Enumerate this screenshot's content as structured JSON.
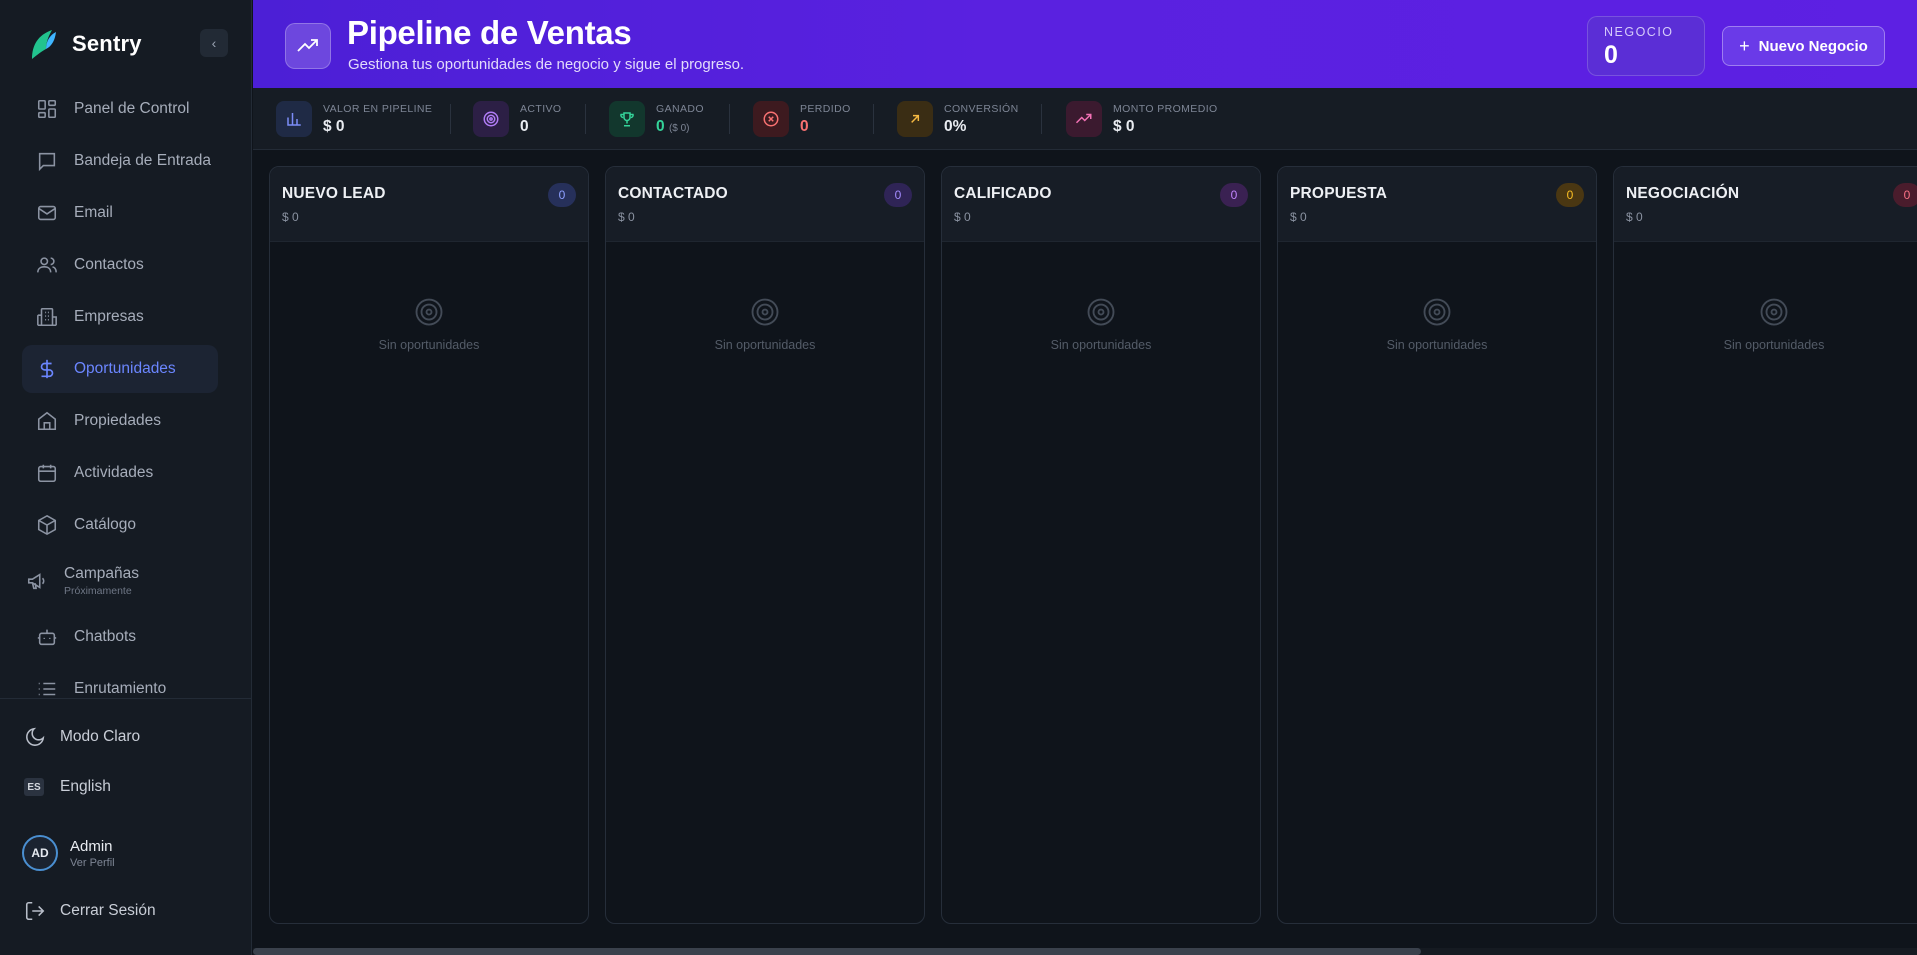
{
  "brand": {
    "name": "Sentry"
  },
  "sidebar": {
    "items": [
      {
        "label": "Panel de Control",
        "icon": "dashboard-icon"
      },
      {
        "label": "Bandeja de Entrada",
        "icon": "inbox-icon"
      },
      {
        "label": "Email",
        "icon": "mail-icon"
      },
      {
        "label": "Contactos",
        "icon": "users-icon"
      },
      {
        "label": "Empresas",
        "icon": "building-icon"
      },
      {
        "label": "Oportunidades",
        "icon": "dollar-icon",
        "active": true
      },
      {
        "label": "Propiedades",
        "icon": "home-icon"
      },
      {
        "label": "Actividades",
        "icon": "calendar-icon"
      },
      {
        "label": "Catálogo",
        "icon": "package-icon"
      },
      {
        "label": "Campañas",
        "sub": "Próximamente",
        "icon": "megaphone-icon"
      },
      {
        "label": "Chatbots",
        "icon": "bot-icon"
      },
      {
        "label": "Enrutamiento",
        "icon": "list-icon"
      }
    ],
    "theme_toggle": "Modo Claro",
    "language_code": "ES",
    "language_label": "English",
    "user": {
      "initials": "AD",
      "name": "Admin",
      "sub": "Ver Perfil"
    },
    "logout": "Cerrar Sesión"
  },
  "header": {
    "title": "Pipeline de Ventas",
    "subtitle": "Gestiona tus oportunidades de negocio y sigue el progreso.",
    "negocio_label": "NEGOCIO",
    "negocio_value": "0",
    "new_button": "Nuevo Negocio"
  },
  "stats": [
    {
      "label": "VALOR EN PIPELINE",
      "value": "$ 0",
      "extra": "",
      "color": "#7c8cf7",
      "bg": "#1f2a45",
      "icon": "bar-chart-icon"
    },
    {
      "label": "ACTIVO",
      "value": "0",
      "extra": "",
      "color": "#b07cf5",
      "bg": "#2c1f45",
      "icon": "target-icon"
    },
    {
      "label": "GANADO",
      "value": "0",
      "extra": "($ 0)",
      "color": "#34d399",
      "bg": "#12372d",
      "icon": "trophy-icon"
    },
    {
      "label": "PERDIDO",
      "value": "0",
      "extra": "",
      "color": "#f87171",
      "bg": "#3d1a1f",
      "icon": "x-circle-icon"
    },
    {
      "label": "CONVERSIÓN",
      "value": "0%",
      "extra": "",
      "color": "#f5b942",
      "bg": "#3a2d14",
      "icon": "arrow-up-right-icon"
    },
    {
      "label": "MONTO PROMEDIO",
      "value": "$ 0",
      "extra": "",
      "color": "#f472b6",
      "bg": "#3b1a2f",
      "icon": "trending-up-icon"
    }
  ],
  "columns": [
    {
      "title": "NUEVO LEAD",
      "count": "0",
      "amount": "$ 0",
      "empty": "Sin oportunidades",
      "badge_bg": "#26305a",
      "badge_fg": "#8ea0ff"
    },
    {
      "title": "CONTACTADO",
      "count": "0",
      "amount": "$ 0",
      "empty": "Sin oportunidades",
      "badge_bg": "#2f2456",
      "badge_fg": "#a48bff"
    },
    {
      "title": "CALIFICADO",
      "count": "0",
      "amount": "$ 0",
      "empty": "Sin oportunidades",
      "badge_bg": "#3a2152",
      "badge_fg": "#c084fc"
    },
    {
      "title": "PROPUESTA",
      "count": "0",
      "amount": "$ 0",
      "empty": "Sin oportunidades",
      "badge_bg": "#4a3712",
      "badge_fg": "#fbbf24"
    },
    {
      "title": "NEGOCIACIÓN",
      "count": "0",
      "amount": "$ 0",
      "empty": "Sin oportunidades",
      "badge_bg": "#4a1c2c",
      "badge_fg": "#fb7185"
    }
  ]
}
